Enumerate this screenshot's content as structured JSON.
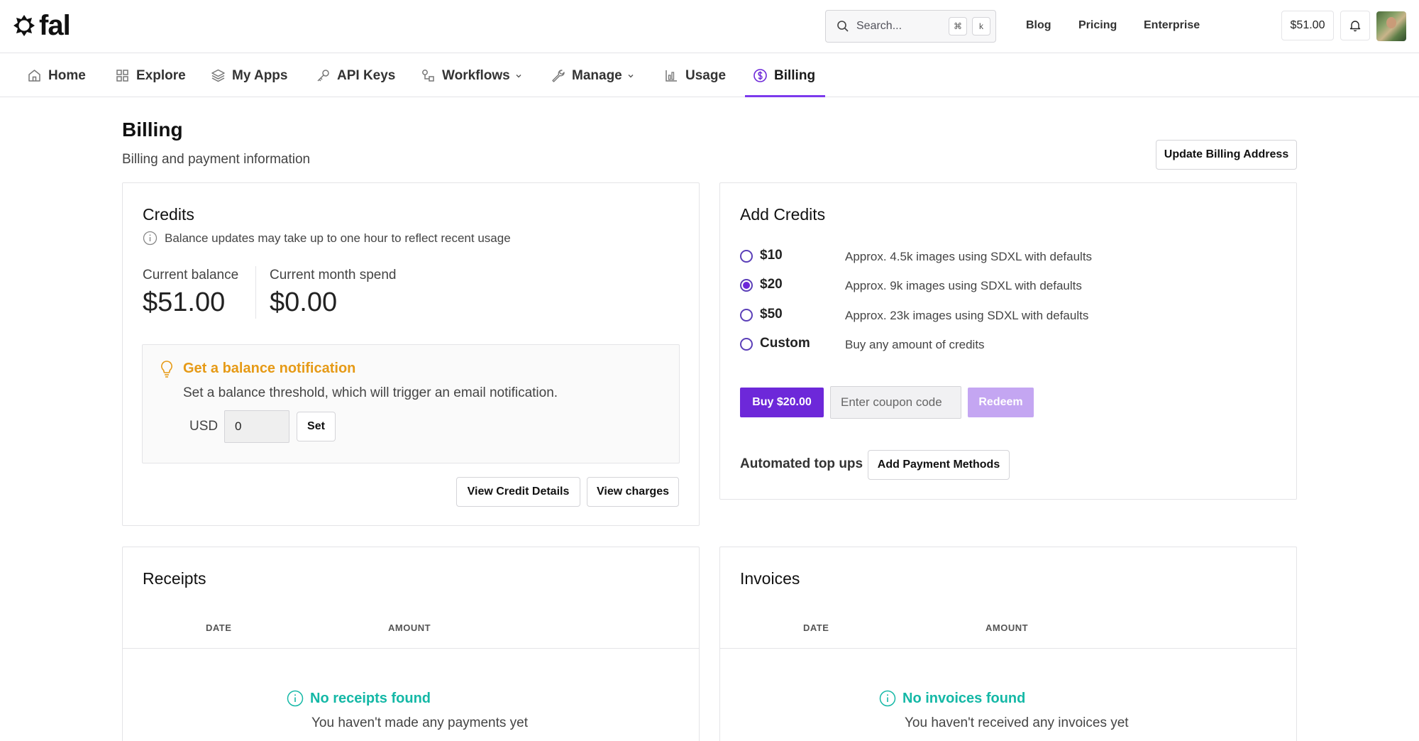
{
  "brand": {
    "name": "fal"
  },
  "search": {
    "placeholder": "Search...",
    "shortcut_mod": "⌘",
    "shortcut_key": "k"
  },
  "top_links": [
    "Blog",
    "Pricing",
    "Enterprise"
  ],
  "header_balance": "$51.00",
  "nav": [
    {
      "label": "Home",
      "icon": "home-icon"
    },
    {
      "label": "Explore",
      "icon": "grid-icon"
    },
    {
      "label": "My Apps",
      "icon": "layers-icon"
    },
    {
      "label": "API Keys",
      "icon": "key-icon"
    },
    {
      "label": "Workflows",
      "icon": "workflow-icon",
      "dropdown": true
    },
    {
      "label": "Manage",
      "icon": "wrench-icon",
      "dropdown": true
    },
    {
      "label": "Usage",
      "icon": "bar-chart-icon"
    },
    {
      "label": "Billing",
      "icon": "dollar-circle-icon",
      "active": true
    }
  ],
  "page": {
    "title": "Billing",
    "subtitle": "Billing and payment information",
    "update_address_label": "Update Billing Address"
  },
  "credits": {
    "title": "Credits",
    "info": "Balance updates may take up to one hour to reflect recent usage",
    "balance_label": "Current balance",
    "balance_value": "$51.00",
    "spend_label": "Current month spend",
    "spend_value": "$0.00",
    "notification": {
      "title": "Get a balance notification",
      "description": "Set a balance threshold, which will trigger an email notification.",
      "currency": "USD",
      "threshold_value": "0",
      "set_label": "Set"
    },
    "view_details_label": "View Credit Details",
    "view_charges_label": "View charges"
  },
  "add_credits": {
    "title": "Add Credits",
    "options": [
      {
        "label": "$10",
        "description": "Approx. 4.5k images using SDXL with defaults",
        "selected": false
      },
      {
        "label": "$20",
        "description": "Approx. 9k images using SDXL with defaults",
        "selected": true
      },
      {
        "label": "$50",
        "description": "Approx. 23k images using SDXL with defaults",
        "selected": false
      },
      {
        "label": "Custom",
        "description": "Buy any amount of credits",
        "selected": false
      }
    ],
    "buy_label": "Buy $20.00",
    "coupon_placeholder": "Enter coupon code",
    "redeem_label": "Redeem",
    "auto_topups_label": "Automated top ups",
    "add_payment_label": "Add Payment Methods"
  },
  "receipts": {
    "title": "Receipts",
    "columns": [
      "DATE",
      "AMOUNT"
    ],
    "empty_title": "No receipts found",
    "empty_sub": "You haven't made any payments yet"
  },
  "invoices": {
    "title": "Invoices",
    "columns": [
      "DATE",
      "AMOUNT"
    ],
    "empty_title": "No invoices found",
    "empty_sub": "You haven't received any invoices yet"
  },
  "colors": {
    "accent": "#6d28d9",
    "warning": "#e69a16",
    "teal": "#14b8a6",
    "redeem_disabled": "#c4a6f2"
  }
}
